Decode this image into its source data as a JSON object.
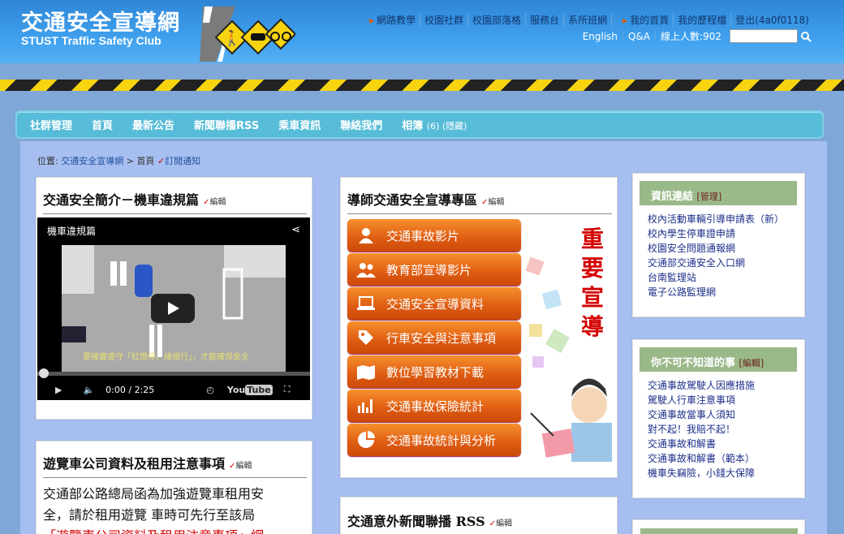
{
  "header": {
    "title": "交通安全宣導網",
    "subtitle": "STUST Traffic Safety Club",
    "top_links": [
      "網路教學",
      "校園社群",
      "校園部落格",
      "服務台",
      "系所班網"
    ],
    "user_links": [
      "我的首頁",
      "我的歷程檔",
      "登出(4a0f0118)"
    ],
    "second_row": [
      "English",
      "Q&A",
      "線上人數:902"
    ]
  },
  "nav": {
    "items": [
      "社群管理",
      "首頁",
      "最新公告",
      "新聞聯播RSS",
      "乘車資訊",
      "聯絡我們"
    ],
    "album": "相簿",
    "album_note": "(6) (隱藏)"
  },
  "breadcrumb": {
    "prefix": "位置:",
    "site": "交通安全宣導網",
    "sep": ">",
    "current": "首頁",
    "subscribe": "訂閱通知"
  },
  "edit_label": "編輯",
  "box1": {
    "title": "交通安全簡介－機車違規篇",
    "video_title": "機車違規篇",
    "time": "0:00 / 2:25",
    "caption": "要確實遵守「紅燈停、綠燈行」，才能確保安全"
  },
  "box2": {
    "title": "導師交通安全宣導專區",
    "buttons": [
      "交通事故影片",
      "教育部宣導影片",
      "交通安全宣導資料",
      "行車安全與注意事項",
      "數位學習教材下載",
      "交通事故保險統計",
      "交通事故統計與分析"
    ],
    "banner_chars": [
      "重",
      "要",
      "宣",
      "導"
    ]
  },
  "box3": {
    "title": "遊覽車公司資料及租用注意事項",
    "body_line1": "交通部公路總局函為加強遊覽車租用安",
    "body_line2": "全，請於租用遊覽 車時可先行至該局",
    "body_line3": "「遊覽車公司資料及租用注意事項」網"
  },
  "box4": {
    "title": "交通意外新聞聯播 RSS"
  },
  "side1": {
    "title": "資訊連結",
    "mgmt": "[管理]",
    "links": [
      "校內活動車輛引導申請表（新）",
      "校內學生停車證申請",
      "校園安全問題通報網",
      "交通部交通安全入口網",
      "台南監理站",
      "電子公路監理網"
    ]
  },
  "side2": {
    "title": "你不可不知道的事",
    "mgmt": "[編輯]",
    "links": [
      "交通事故駕駛人因應措施",
      "駕駛人行車注意事項",
      "交通事故當事人須知",
      "對不起！我賠不起！",
      "交通事故和解書",
      "交通事故和解書（範本）",
      "機車失竊險，小錢大保障"
    ]
  },
  "colors": {
    "header": "#3fa0ee",
    "nav": "#56bcd8",
    "button": "#de5b12",
    "sidehead": "#9ab989"
  }
}
